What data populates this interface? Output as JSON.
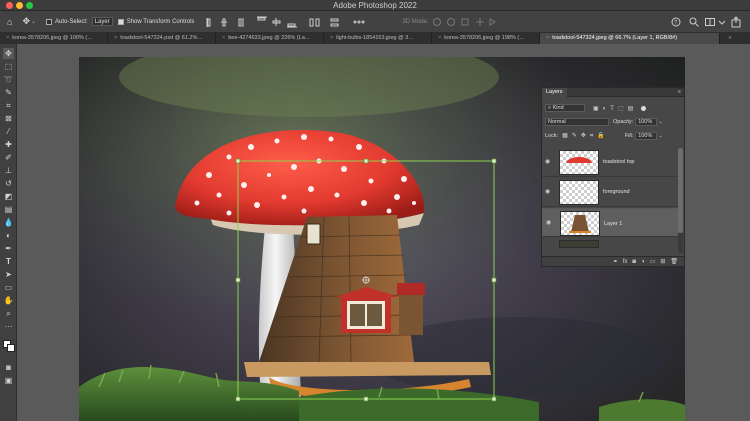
{
  "app": {
    "title": "Adobe Photoshop 2022"
  },
  "options": {
    "auto_select_label": "Auto-Select:",
    "auto_select_value": "Layer",
    "transform_controls_label": "Show Transform Controls",
    "mode_3d_label": "3D Mode:"
  },
  "tabs": [
    "korea-3578206.jpeg @ 100% (…",
    "toadstool-547324.psd @ 61.2%…",
    "bee-4274633.jpeg @ 226% (La…",
    "light-bulbs-1854163.jpeg @ 3…",
    "korea-3578206.jpeg @ 198% (…",
    "toadstool-547324.jpeg @ 66.7% (Layer 1, RGB/8#)"
  ],
  "layers_panel": {
    "tab_label": "Layers",
    "filter_kind": "Kind",
    "blend_mode": "Normal",
    "opacity_label": "Opacity:",
    "opacity_value": "100%",
    "lock_label": "Lock:",
    "fill_label": "Fill:",
    "fill_value": "100%",
    "layers": [
      {
        "name": "toadstool top",
        "selected": false
      },
      {
        "name": "foreground",
        "selected": false
      },
      {
        "name": "Layer 1",
        "selected": true
      }
    ]
  },
  "colors": {
    "accent_selection": "#8fd14f",
    "panel_bg": "#474747",
    "app_bg": "#535353"
  }
}
